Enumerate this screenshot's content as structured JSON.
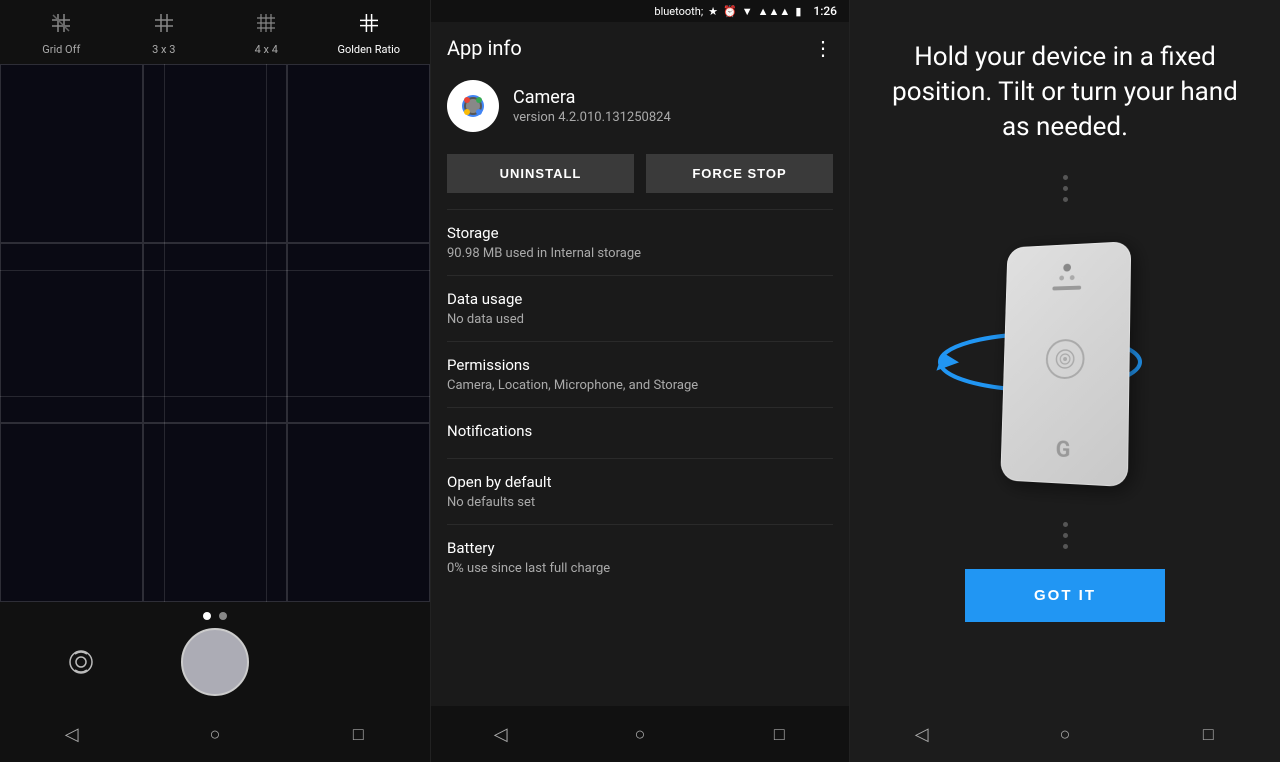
{
  "camera_panel": {
    "toolbar": {
      "items": [
        {
          "id": "grid-off",
          "label": "Grid Off",
          "active": false
        },
        {
          "id": "3x3",
          "label": "3 x 3",
          "active": false
        },
        {
          "id": "4x4",
          "label": "4 x 4",
          "active": false
        },
        {
          "id": "golden",
          "label": "Golden Ratio",
          "active": true
        }
      ]
    },
    "nav": {
      "back": "◁",
      "home": "○",
      "recents": "□"
    }
  },
  "appinfo_panel": {
    "status_bar": {
      "time": "1:26",
      "icons": [
        "bluetooth",
        "alarm",
        "wifi",
        "signal",
        "battery"
      ]
    },
    "title": "App info",
    "app": {
      "name": "Camera",
      "version": "version 4.2.010.131250824"
    },
    "buttons": {
      "uninstall": "UNINSTALL",
      "force_stop": "FORCE STOP"
    },
    "sections": [
      {
        "label": "Storage",
        "value": "90.98 MB used in Internal storage"
      },
      {
        "label": "Data usage",
        "value": "No data used"
      },
      {
        "label": "Permissions",
        "value": "Camera, Location, Microphone, and Storage"
      },
      {
        "label": "Notifications",
        "value": ""
      },
      {
        "label": "Open by default",
        "value": "No defaults set"
      },
      {
        "label": "Battery",
        "value": "0% use since last full charge"
      }
    ],
    "nav": {
      "back": "◁",
      "home": "○",
      "recents": "□"
    }
  },
  "tutorial_panel": {
    "heading": "Hold your device in a fixed position. Tilt or turn your hand as needed.",
    "got_it_label": "GOT IT",
    "nav": {
      "back": "◁",
      "home": "○",
      "recents": "□"
    }
  }
}
